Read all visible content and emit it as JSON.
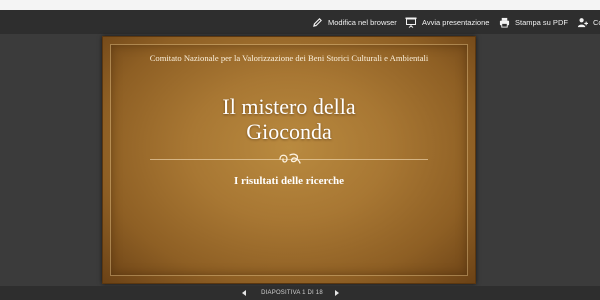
{
  "toolbar": {
    "edit_label": "Modifica nel browser",
    "present_label": "Avvia presentazione",
    "pdf_label": "Stampa su PDF",
    "more_label": "Co"
  },
  "slide": {
    "organization": "Comitato Nazionale per la Valorizzazione dei Beni Storici Culturali e Ambientali",
    "title_line1": "Il mistero della",
    "title_line2": "Gioconda",
    "subtitle": "I risultati delle ricerche"
  },
  "footer": {
    "counter": "DIAPOSITIVA 1 DI 18"
  },
  "icons": {
    "edit": "pencil-icon",
    "present": "presentation-screen-icon",
    "pdf": "printer-icon",
    "more": "add-person-icon",
    "ornament": "decorative-flourish",
    "prev": "triangle-left-icon",
    "next": "triangle-right-icon"
  },
  "colors": {
    "toolbar_bg": "#2e2e2e",
    "stage_bg": "#3b3b3b",
    "slide_gold": "#a87733",
    "slide_border": "#5b3710",
    "text_light": "#f2f2f2"
  }
}
